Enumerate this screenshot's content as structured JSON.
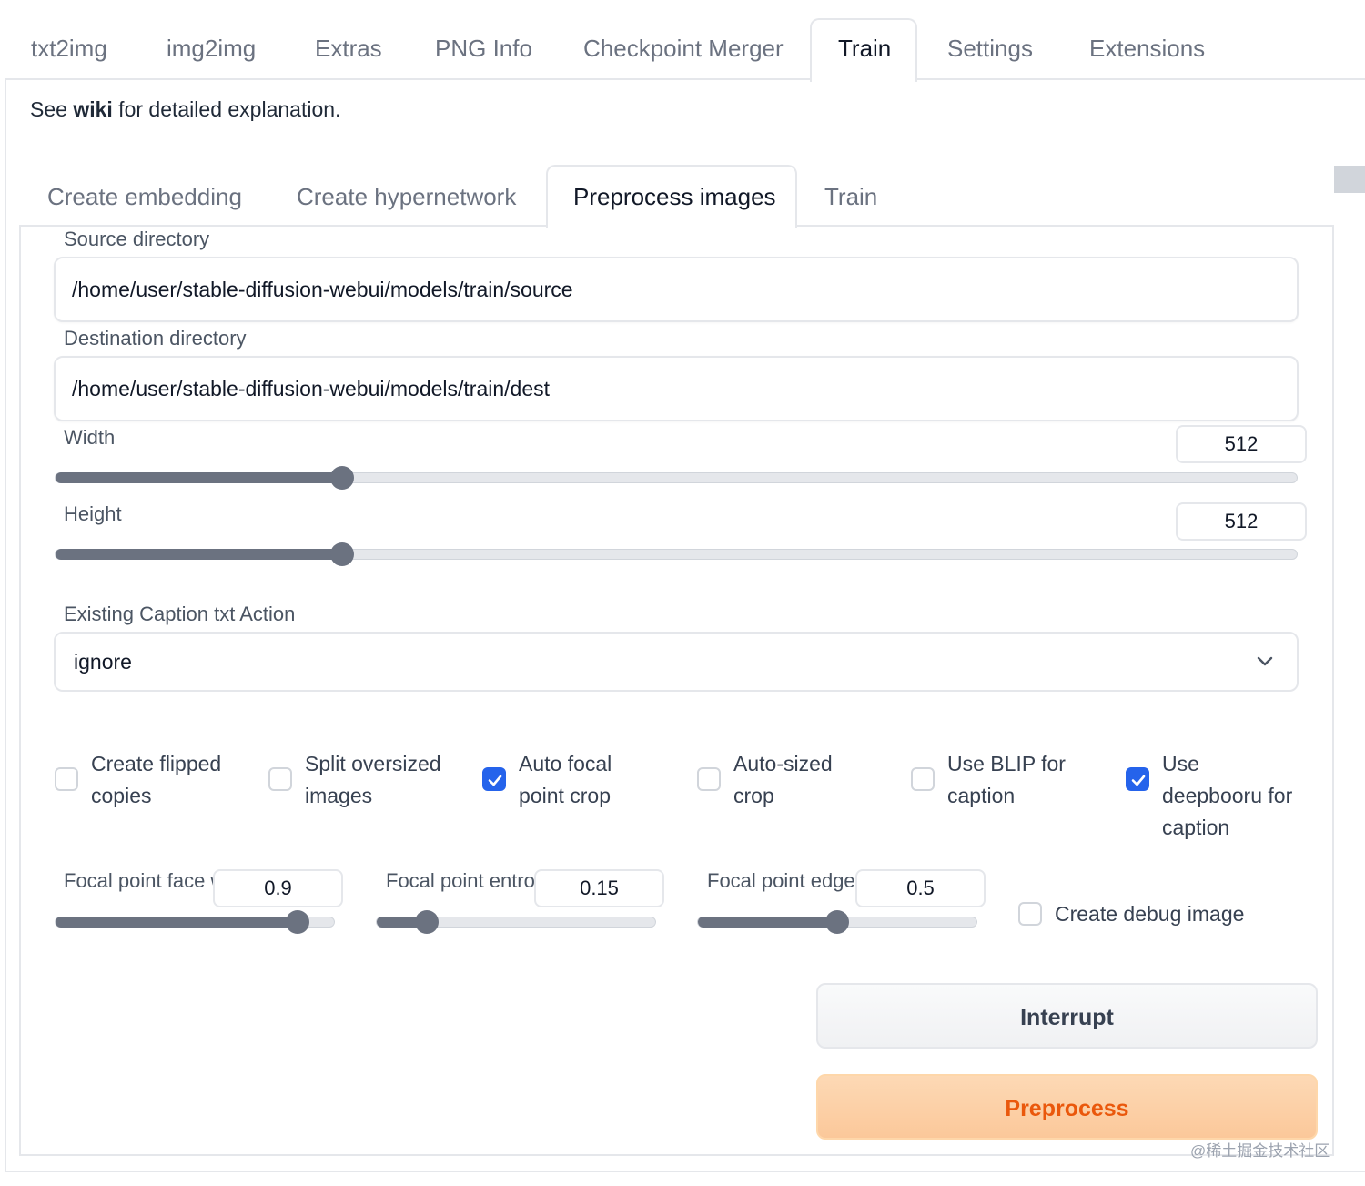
{
  "top_tabs": {
    "items": [
      "txt2img",
      "img2img",
      "Extras",
      "PNG Info",
      "Checkpoint Merger",
      "Train",
      "Settings",
      "Extensions"
    ],
    "active": "Train"
  },
  "wiki": {
    "prefix": "See ",
    "link": "wiki",
    "suffix": " for detailed explanation."
  },
  "sub_tabs": {
    "items": [
      "Create embedding",
      "Create hypernetwork",
      "Preprocess images",
      "Train"
    ],
    "active": "Preprocess images"
  },
  "source_directory": {
    "label": "Source directory",
    "value": "/home/user/stable-diffusion-webui/models/train/source"
  },
  "destination_directory": {
    "label": "Destination directory",
    "value": "/home/user/stable-diffusion-webui/models/train/dest"
  },
  "width": {
    "label": "Width",
    "value": "512",
    "fraction": 0.231
  },
  "height": {
    "label": "Height",
    "value": "512",
    "fraction": 0.231
  },
  "caption_action": {
    "label": "Existing Caption txt Action",
    "value": "ignore"
  },
  "checkboxes": [
    {
      "label_lines": [
        "Create flipped",
        "copies"
      ],
      "checked": false
    },
    {
      "label_lines": [
        "Split oversized",
        "images"
      ],
      "checked": false
    },
    {
      "label_lines": [
        "Auto focal",
        "point crop"
      ],
      "checked": true
    },
    {
      "label_lines": [
        "Auto-sized",
        "crop"
      ],
      "checked": false
    },
    {
      "label_lines": [
        "Use BLIP for",
        "caption"
      ],
      "checked": false
    },
    {
      "label_lines": [
        "Use",
        "deepbooru for",
        "caption"
      ],
      "checked": true
    }
  ],
  "focal_face": {
    "label": "Focal point face w",
    "value": "0.9",
    "fraction": 0.87
  },
  "focal_entropy": {
    "label": "Focal point entropy",
    "value": "0.15",
    "fraction": 0.18
  },
  "focal_edges": {
    "label": "Focal point edges",
    "value": "0.5",
    "fraction": 0.5
  },
  "debug_image": {
    "label": "Create debug image",
    "checked": false
  },
  "buttons": {
    "interrupt": "Interrupt",
    "preprocess": "Preprocess"
  },
  "watermark": "@稀土掘金技术社区",
  "colors": {
    "accent_blue": "#2563eb",
    "preprocess_orange": "#ea580c",
    "slider_fill": "#6b7280"
  }
}
